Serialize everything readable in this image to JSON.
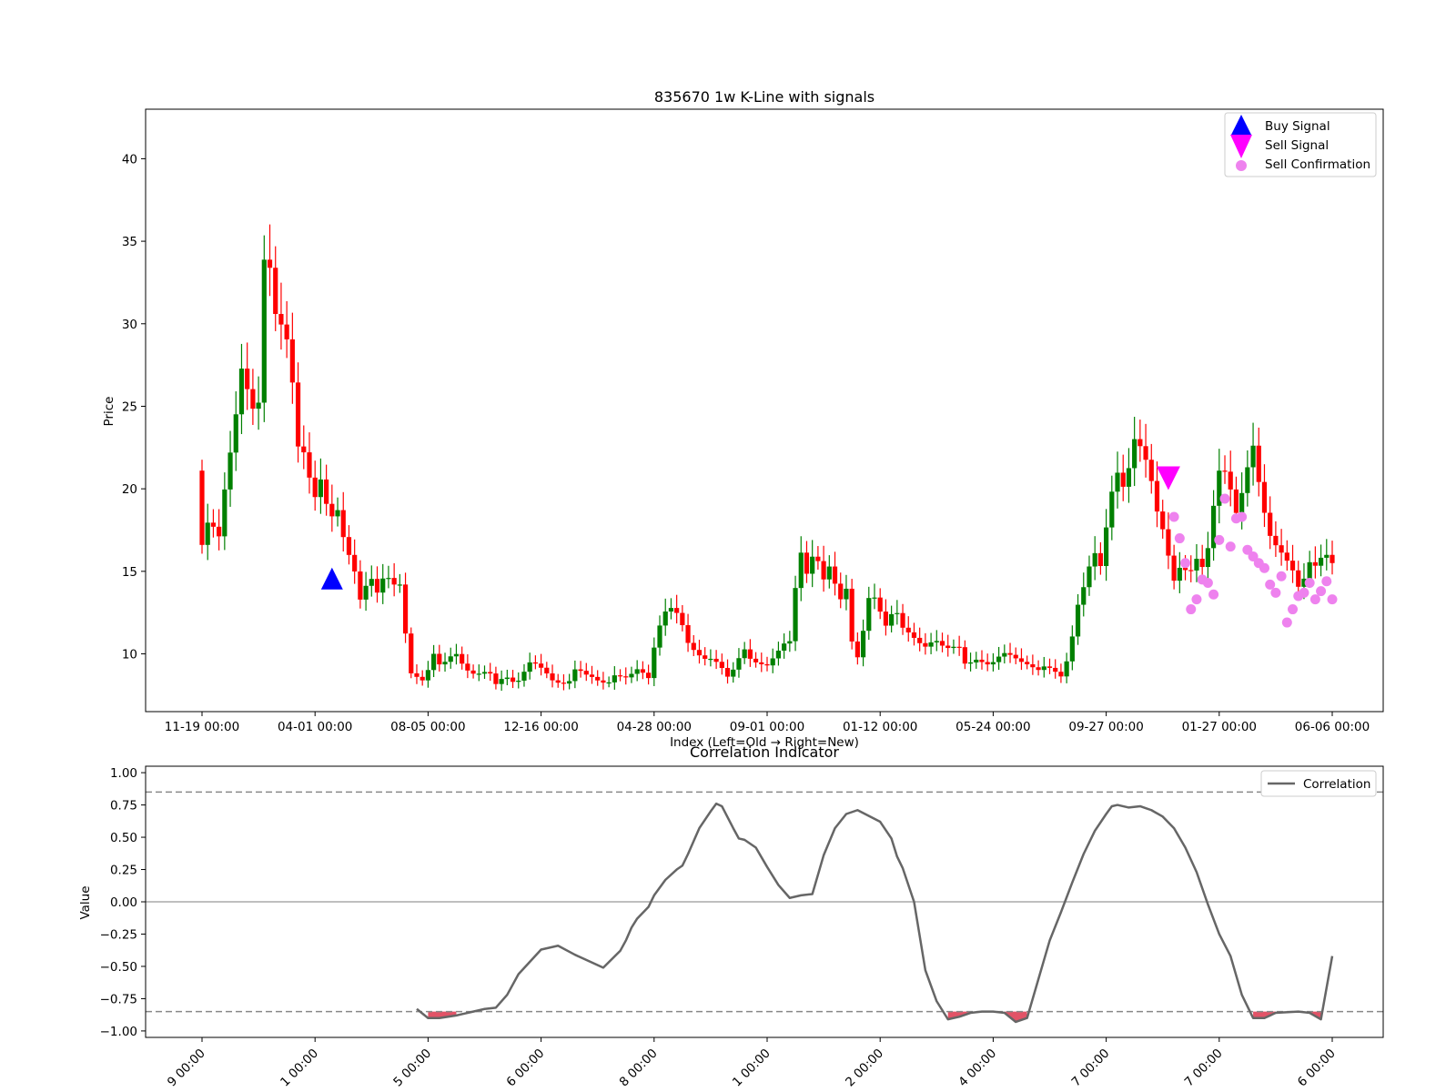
{
  "chart_data": [
    {
      "type": "candlestick",
      "title": "835670 1w K-Line with signals",
      "xlabel": "Index (Left=Old → Right=New)",
      "ylabel": "Price",
      "ylim": [
        6.5,
        43
      ],
      "yticks": [
        10,
        15,
        20,
        25,
        30,
        35,
        40
      ],
      "xtick_labels": [
        "11-19 00:00",
        "04-01 00:00",
        "08-05 00:00",
        "12-16 00:00",
        "04-28 00:00",
        "09-01 00:00",
        "01-12 00:00",
        "05-24 00:00",
        "09-27 00:00",
        "01-27 00:00",
        "06-06 00:00"
      ],
      "xtick_index": [
        0,
        20,
        40,
        60,
        80,
        100,
        120,
        140,
        160,
        180,
        200
      ],
      "x_count": 201,
      "close": [
        16.6,
        18.5,
        16.6,
        20.6,
        23.5,
        27.4,
        25.4,
        24,
        36.2,
        30.8,
        29.9,
        28.6,
        22.6,
        22.1,
        19.2,
        20.7,
        18.1,
        18.8,
        16.5,
        15.4,
        13,
        14.9,
        13.7,
        14.9,
        14.2,
        14.2,
        8.9,
        8.6,
        8.3,
        10.1,
        9.2,
        9.8,
        10,
        9.1,
        8.8,
        8.8,
        9,
        8.1,
        8.7,
        8.3,
        8.4,
        9.5,
        9.4,
        9,
        8.4,
        8.2,
        8.2,
        9.2,
        8.8,
        8.6,
        8.3,
        8.2,
        8.8,
        8.5,
        8.8,
        9.2,
        8.3,
        10.9,
        12.5,
        12.8,
        12.3,
        10.7,
        10.1,
        9.7,
        9.7,
        9.4,
        8.6,
        9.2,
        10.4,
        9.6,
        9.4,
        9.3,
        9.9,
        10.6,
        10.8,
        16.6,
        14.8,
        16.4,
        14.4,
        15.5,
        13.1,
        14,
        9,
        11.2,
        14,
        12.8,
        11.6,
        12.9,
        11.6,
        11.2,
        10.7,
        10.4,
        10.9,
        10.5,
        10.3,
        10.6,
        9.2,
        9.7,
        9.5,
        9.3,
        9.8,
        10.1,
        9.8,
        9.5,
        9.3,
        9,
        9.3,
        9,
        8.6,
        10.1,
        12.9,
        14.4,
        16.3,
        15.2,
        19.3,
        21,
        19.8,
        23.1,
        22.5,
        21.2,
        18.6,
        17.1,
        14.3,
        15.4,
        14.8,
        15.8,
        15,
        18.7,
        21.7,
        20.4,
        18.4,
        20.5,
        22.8,
        19.7,
        17.3,
        16.5,
        15.9,
        15.1,
        13.7,
        15.6,
        15.3,
        16.2,
        15.5
      ],
      "series": [
        {
          "name": "Buy Signal",
          "type": "marker",
          "index": [
            23
          ],
          "values": [
            14.4
          ]
        },
        {
          "name": "Sell Signal",
          "type": "marker",
          "index": [
            171
          ],
          "values": [
            20.7
          ]
        },
        {
          "name": "Sell Confirmation",
          "type": "scatter",
          "index": [
            172,
            173,
            174,
            175,
            176,
            177,
            178,
            179,
            180,
            181,
            182,
            183,
            184,
            185,
            186,
            187,
            188,
            189,
            190,
            191,
            192,
            193,
            194,
            195,
            196,
            197,
            198,
            199,
            200
          ],
          "values": [
            18.3,
            17,
            15.5,
            12.7,
            13.3,
            14.5,
            14.3,
            13.6,
            16.9,
            19.4,
            16.5,
            18.2,
            18.3,
            16.3,
            15.9,
            15.5,
            15.2,
            14.2,
            13.7,
            14.7,
            11.9,
            12.7,
            13.5,
            13.7,
            14.3,
            13.3,
            13.8,
            14.4,
            13.3
          ]
        }
      ],
      "legend": [
        "Buy Signal",
        "Sell Signal",
        "Sell Confirmation"
      ],
      "legend_position": "top-right",
      "colors": {
        "up": "#008000",
        "down": "#ff0000",
        "buy": "#0000ff",
        "sell": "#ff00ff",
        "confirm": "#ee82ee"
      }
    },
    {
      "type": "line",
      "title": "Correlation Indicator",
      "xlabel": "",
      "ylabel": "Value",
      "ylim": [
        -1.05,
        1.05
      ],
      "yticks": [
        -1.0,
        -0.75,
        -0.5,
        -0.25,
        0.0,
        0.25,
        0.5,
        0.75,
        1.0
      ],
      "ytick_labels": [
        "−1.00",
        "−0.75",
        "−0.50",
        "−0.25",
        "0.00",
        "0.25",
        "0.50",
        "0.75",
        "1.00"
      ],
      "xtick_labels": [
        "9 00:00",
        "1 00:00",
        "5 00:00",
        "6 00:00",
        "8 00:00",
        "1 00:00",
        "2 00:00",
        "4 00:00",
        "7 00:00",
        "7 00:00",
        "6 00:00"
      ],
      "xtick_index": [
        0,
        20,
        40,
        60,
        80,
        100,
        120,
        140,
        160,
        180,
        200
      ],
      "x_count": 201,
      "series": [
        {
          "name": "Correlation",
          "color": "#666666",
          "x": [
            38,
            40,
            42,
            45,
            48,
            50,
            52,
            54,
            56,
            60,
            63,
            66,
            71,
            74,
            75,
            76,
            77,
            79,
            80,
            82,
            84,
            85,
            86,
            88,
            90,
            91,
            92,
            94,
            95,
            96,
            98,
            100,
            102,
            104,
            106,
            108,
            110,
            112,
            114,
            116,
            120,
            122,
            123,
            124,
            126,
            128,
            130,
            132,
            134,
            136,
            138,
            140,
            142,
            144,
            146,
            148,
            150,
            152,
            154,
            156,
            158,
            160,
            161,
            162,
            164,
            166,
            168,
            170,
            172,
            174,
            176,
            178,
            180,
            182,
            184,
            186,
            188,
            190,
            194,
            196,
            198,
            200
          ],
          "values": [
            -0.83,
            -0.9,
            -0.9,
            -0.88,
            -0.85,
            -0.83,
            -0.82,
            -0.72,
            -0.56,
            -0.37,
            -0.34,
            -0.41,
            -0.51,
            -0.38,
            -0.3,
            -0.2,
            -0.13,
            -0.04,
            0.05,
            0.17,
            0.25,
            0.28,
            0.37,
            0.57,
            0.7,
            0.76,
            0.74,
            0.57,
            0.49,
            0.48,
            0.42,
            0.27,
            0.13,
            0.03,
            0.05,
            0.06,
            0.36,
            0.57,
            0.68,
            0.71,
            0.62,
            0.49,
            0.35,
            0.26,
            0.0,
            -0.53,
            -0.77,
            -0.91,
            -0.89,
            -0.86,
            -0.85,
            -0.85,
            -0.86,
            -0.93,
            -0.9,
            -0.6,
            -0.3,
            -0.08,
            0.15,
            0.37,
            0.55,
            0.68,
            0.74,
            0.75,
            0.73,
            0.74,
            0.71,
            0.66,
            0.57,
            0.42,
            0.23,
            -0.02,
            -0.25,
            -0.42,
            -0.72,
            -0.9,
            -0.9,
            -0.86,
            -0.85,
            -0.86,
            -0.91,
            -0.42
          ]
        }
      ],
      "reference_lines": [
        0.85,
        0.0,
        -0.85
      ],
      "shaded_below": -0.85,
      "shade_color": "#e04a5f",
      "legend": [
        "Correlation"
      ],
      "legend_position": "top-right"
    }
  ]
}
